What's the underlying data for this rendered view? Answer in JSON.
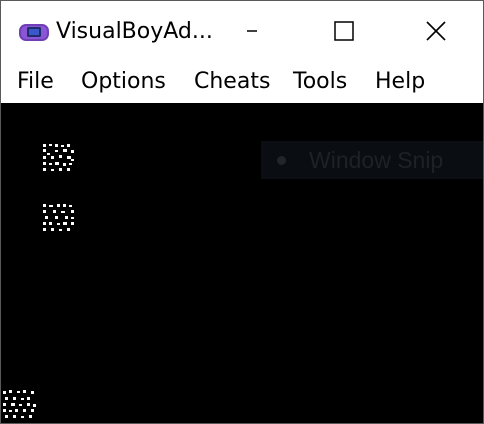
{
  "window": {
    "title": "VisualBoyAd...",
    "icon": "gameboy-advance-icon"
  },
  "titlebar_buttons": {
    "minimize_icon": "minimize-icon",
    "maximize_icon": "maximize-icon",
    "close_icon": "close-icon"
  },
  "menu": {
    "items": [
      {
        "label": "File"
      },
      {
        "label": "Options"
      },
      {
        "label": "Cheats"
      },
      {
        "label": "Tools"
      },
      {
        "label": "Help"
      }
    ]
  },
  "overlay": {
    "label": "Window Snip"
  },
  "colors": {
    "game_background": "#000000",
    "window_background": "#ffffff",
    "app_icon_body": "#6f3fb5",
    "app_icon_screen": "#1e2d6e"
  }
}
